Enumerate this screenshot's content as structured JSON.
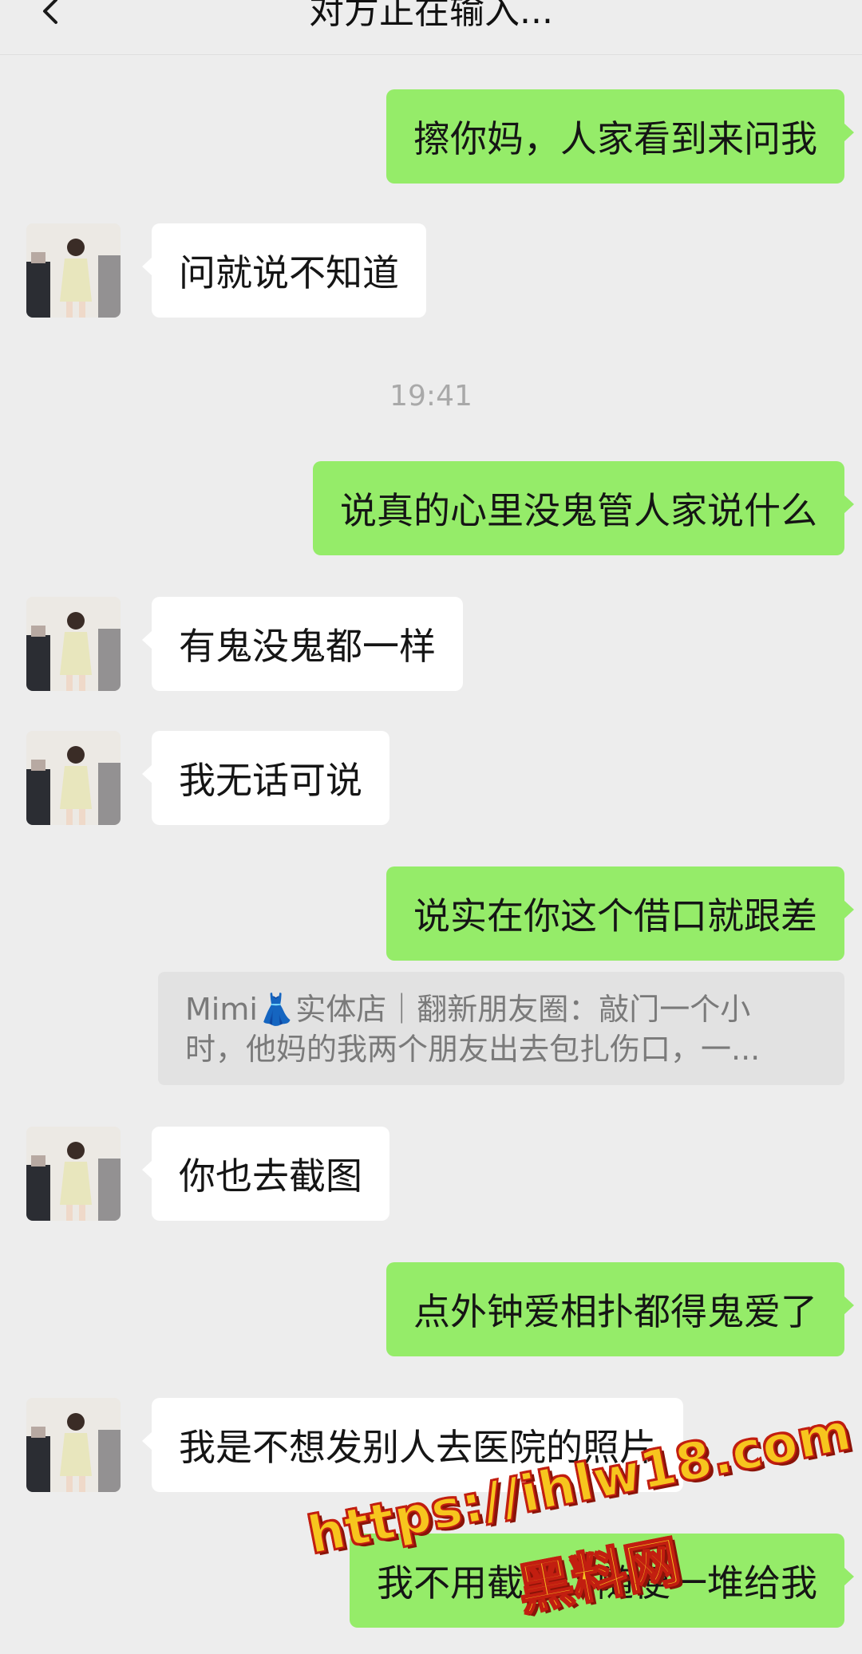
{
  "header": {
    "title": "对方正在输入...",
    "back_icon": "chevron-left-icon"
  },
  "colors": {
    "background": "#ededed",
    "outgoing_bubble": "#95ec69",
    "incoming_bubble": "#ffffff",
    "watermark_fill": "#f7c51e",
    "watermark_stroke": "#c21e10"
  },
  "messages": [
    {
      "direction": "out",
      "text": "擦你妈，人家看到来问我"
    },
    {
      "direction": "in",
      "text": "问就说不知道"
    },
    {
      "type": "time",
      "text": "19:41"
    },
    {
      "direction": "out",
      "text": "说真的心里没鬼管人家说什么"
    },
    {
      "direction": "in",
      "text": "有鬼没鬼都一样"
    },
    {
      "direction": "in",
      "text": "我无话可说"
    },
    {
      "direction": "out",
      "text": "说实在你这个借口就跟差"
    },
    {
      "type": "quote",
      "line1": "Mimi👗实体店｜翻新朋友圈：敲门一个小",
      "line2": "时，他妈的我两个朋友出去包扎伤口，一..."
    },
    {
      "direction": "in",
      "text": "你也去截图"
    },
    {
      "direction": "out",
      "text": "点外钟爱相扑都得鬼爱了"
    },
    {
      "direction": "in",
      "text": "我是不想发别人去医院的照片"
    },
    {
      "direction": "out",
      "text": "我不用截图，随便一堆给我"
    }
  ],
  "watermark": {
    "url": "https://ihlw18.com",
    "name": "黑料网"
  }
}
